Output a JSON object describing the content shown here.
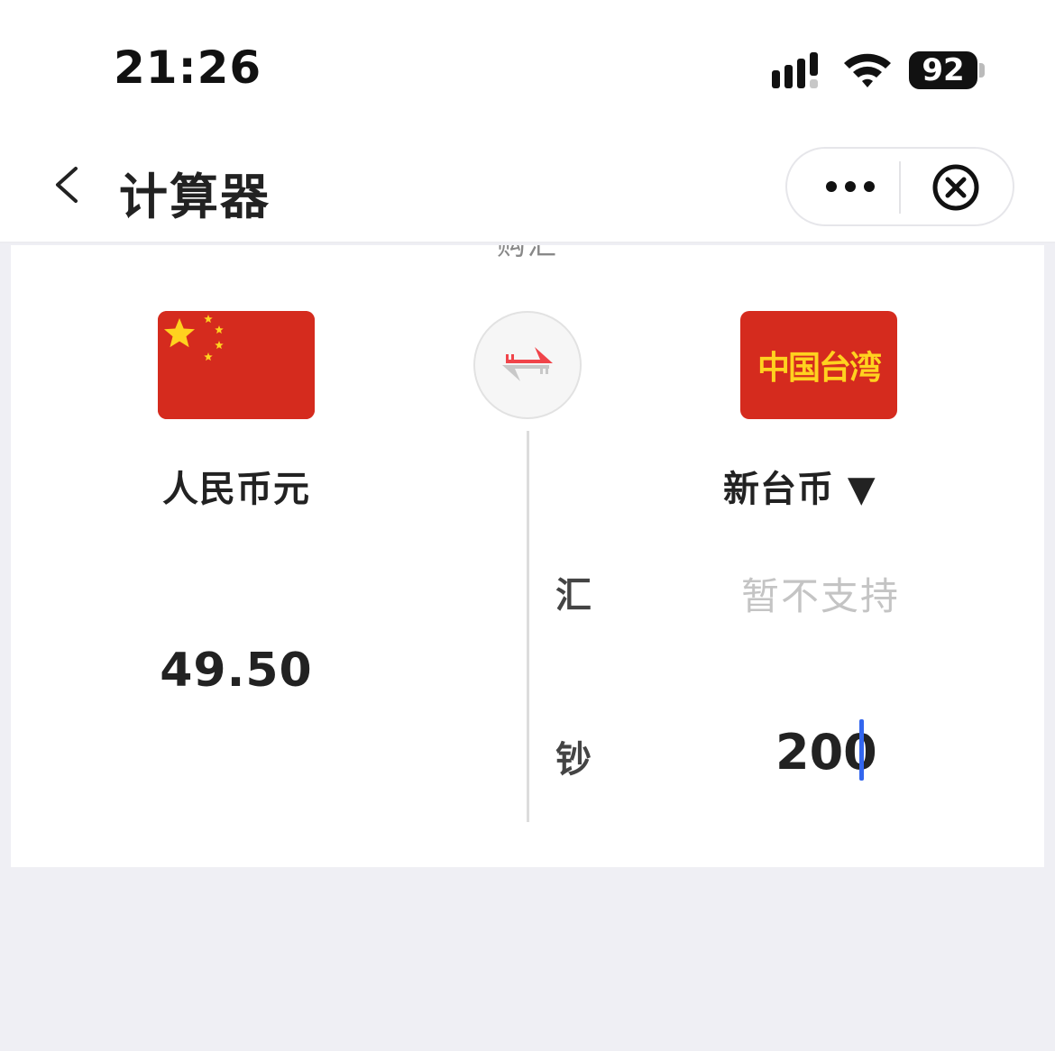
{
  "status_bar": {
    "time": "21:26",
    "battery": "92",
    "icons": [
      "signal-icon",
      "wifi-icon",
      "battery-icon"
    ]
  },
  "nav": {
    "title": "计算器",
    "icons": [
      "back-chevron-icon",
      "more-dots-icon",
      "close-circle-icon"
    ]
  },
  "card": {
    "section_label": "购汇",
    "left": {
      "flag": "china-flag-icon",
      "currency": "人民币元",
      "amount": "49.50"
    },
    "swap_icon": "swap-arrows-icon",
    "right": {
      "flag_text": "中国台湾",
      "currency": "新台币 ▼",
      "rate_label": "汇",
      "rate_value": "暂不支持",
      "cash_label": "钞",
      "cash_amount": "200"
    }
  },
  "colors": {
    "flag_red": "#d52b1e",
    "flag_yellow": "#ffd21f",
    "swap_red": "#f0444a",
    "cursor_blue": "#3366ee"
  }
}
